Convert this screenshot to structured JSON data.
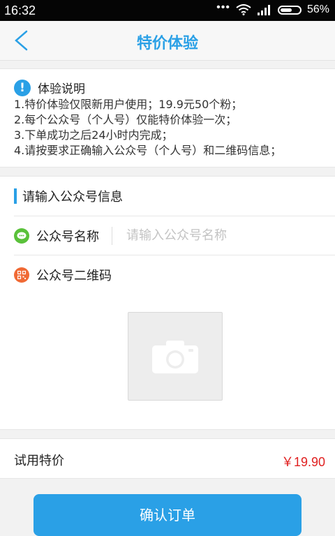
{
  "statusbar": {
    "time": "16:32",
    "dots": "•••",
    "battery": "56%"
  },
  "header": {
    "title": "特价体验"
  },
  "notice": {
    "title": "体验说明",
    "lines": [
      "1.特价体验仅限新用户使用；19.9元50个粉；",
      "2.每个公众号（个人号）仅能特价体验一次；",
      "3.下单成功之后24小时内完成；",
      "4.请按要求正确输入公众号（个人号）和二维码信息；"
    ]
  },
  "form": {
    "section_title": "请输入公众号信息",
    "name_label": "公众号名称",
    "name_placeholder": "请输入公众号名称",
    "qr_label": "公众号二维码"
  },
  "price": {
    "label": "试用特价",
    "value": "￥19.90"
  },
  "confirm": {
    "label": "确认订单"
  },
  "colors": {
    "accent": "#2aa0e6",
    "price": "#e02020",
    "wechat_green": "#5ac13a",
    "qr_orange": "#f06a35"
  }
}
